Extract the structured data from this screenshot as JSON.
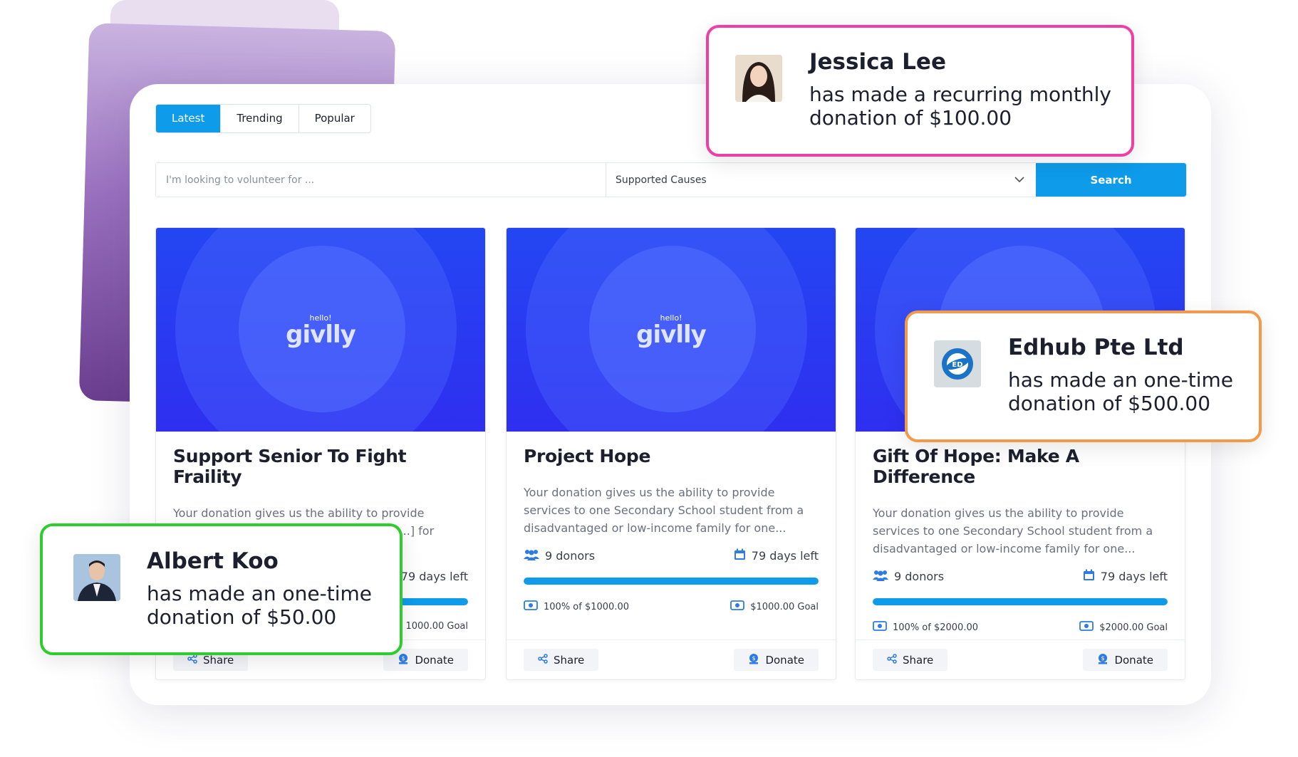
{
  "tabs": [
    {
      "label": "Latest",
      "active": true
    },
    {
      "label": "Trending",
      "active": false
    },
    {
      "label": "Popular",
      "active": false
    }
  ],
  "search": {
    "placeholder": "I'm looking to volunteer for ...",
    "select_value": "Supported Causes",
    "button_label": "Search"
  },
  "campaigns": [
    {
      "logo_small": "hello!",
      "logo_main": "givlly",
      "title": "Support Senior To Fight Fraility",
      "description": "Your donation gives us the ability to provide counselling or therapy services to one [...] for one...",
      "donors": "",
      "days_left": "79 days left",
      "progress_percent": 100,
      "raised": "",
      "goal": "1000.00 Goal",
      "share_label": "Share",
      "donate_label": "Donate"
    },
    {
      "logo_small": "hello!",
      "logo_main": "givlly",
      "title": "Project Hope",
      "description": "Your donation gives us the ability to provide services to one Secondary School student from a disadvantaged or low-income family for one...",
      "donors": "9 donors",
      "days_left": "79 days left",
      "progress_percent": 100,
      "raised": "100% of $1000.00",
      "goal": "$1000.00 Goal",
      "share_label": "Share",
      "donate_label": "Donate"
    },
    {
      "logo_small": "",
      "logo_main": "",
      "title": "Gift Of Hope: Make A Difference",
      "description": "Your donation gives us the ability to provide services to one Secondary School student from a disadvantaged or low-income family for one...",
      "donors": "9 donors",
      "days_left": "79 days left",
      "progress_percent": 100,
      "raised": "100% of $2000.00",
      "goal": "$2000.00 Goal",
      "share_label": "Share",
      "donate_label": "Donate"
    }
  ],
  "notifications": [
    {
      "name": "Jessica Lee",
      "message": "has made a recurring monthly donation of $100.00",
      "border_color": "#ef3fa5",
      "avatar": "woman-photo"
    },
    {
      "name": "Edhub Pte Ltd",
      "message": "has made an one-time donation of $500.00",
      "border_color": "#f29a4a",
      "avatar": "edhub-logo"
    },
    {
      "name": "Albert Koo",
      "message": "has made an one-time donation of $50.00",
      "border_color": "#2fcc2f",
      "avatar": "man-photo"
    }
  ],
  "colors": {
    "accent": "#0d9bea",
    "banner": "#2446f2",
    "purple_card": "#8b5fb3"
  },
  "icons": [
    "chevron-down-icon",
    "users-icon",
    "calendar-icon",
    "money-icon",
    "share-icon",
    "donate-icon"
  ]
}
